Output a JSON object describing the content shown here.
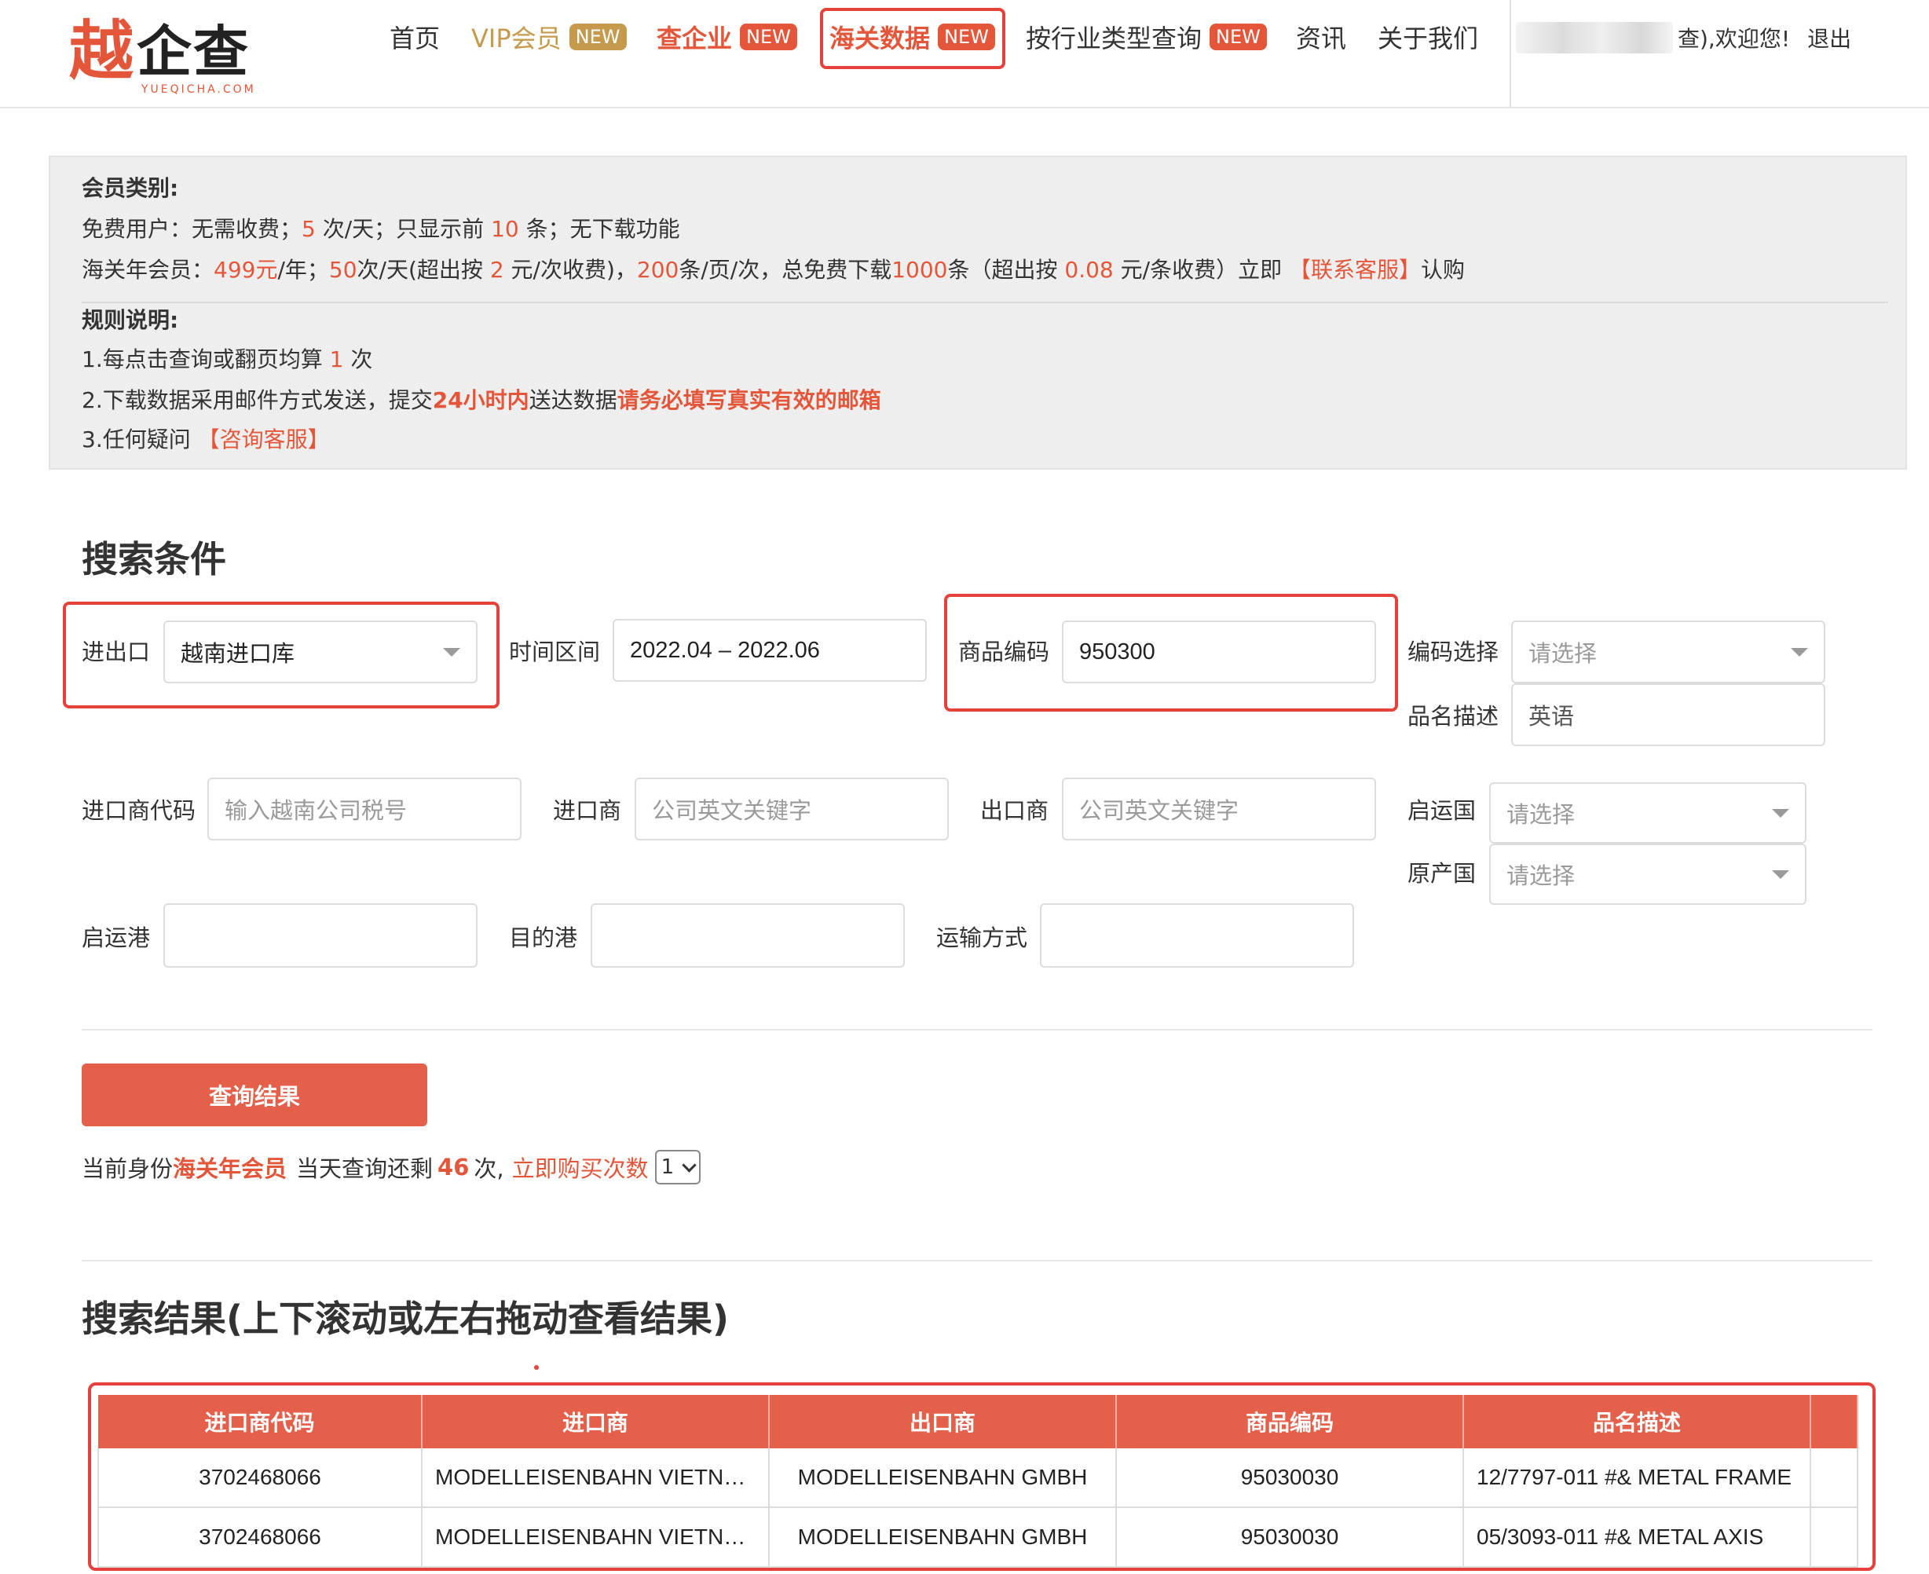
{
  "header": {
    "logo": {
      "main": "越",
      "rest": "企查",
      "sub": "YUEQICHA.COM"
    },
    "nav": [
      {
        "label": "首页"
      },
      {
        "label": "VIP会员",
        "badge": "NEW"
      },
      {
        "label": "查企业",
        "badge": "NEW"
      },
      {
        "label": "海关数据",
        "badge": "NEW"
      },
      {
        "label": "按行业类型查询",
        "badge": "NEW"
      },
      {
        "label": "资讯"
      },
      {
        "label": "关于我们"
      }
    ],
    "user": {
      "welcome": "查),欢迎您!",
      "logout": "退出"
    }
  },
  "membership": {
    "title": "会员类别:",
    "free": {
      "prefix": "免费用户：无需收费；",
      "times": "5",
      "mid": " 次/天；只显示前 ",
      "rows": "10",
      "suffix": " 条；无下载功能"
    },
    "annual": {
      "prefix": "海关年会员：",
      "price": "499元",
      "t1": "/年；",
      "times": "50",
      "t2": "次/天(超出按 ",
      "over_price": "2",
      "t3": " 元/次收费)，",
      "rows": "200",
      "t4": "条/页/次，总免费下载",
      "downloads": "1000",
      "t5": "条（超出按 ",
      "row_price": "0.08",
      "t6": " 元/条收费）立即 ",
      "contact": "【联系客服】",
      "t7": "认购"
    }
  },
  "rules": {
    "title": "规则说明:",
    "r1": {
      "prefix": "1.每点击查询或翻页均算 ",
      "count": "1",
      "suffix": " 次"
    },
    "r2": {
      "prefix": "2.下载数据采用邮件方式发送，提交",
      "hours": "24小时内",
      "mid": "送达数据",
      "email": "请务必填写真实有效的邮箱"
    },
    "r3": {
      "prefix": "3.任何疑问 ",
      "link": "【咨询客服】"
    }
  },
  "search": {
    "heading": "搜索条件",
    "direction": {
      "label": "进出口",
      "value": "越南进口库"
    },
    "period": {
      "label": "时间区间",
      "value": "2022.04 – 2022.06"
    },
    "hs_code": {
      "label": "商品编码",
      "value": "950300"
    },
    "code_select": {
      "label": "编码选择",
      "placeholder": "请选择"
    },
    "product_desc": {
      "label": "品名描述",
      "value": "英语"
    },
    "importer_code": {
      "label": "进口商代码",
      "placeholder": "输入越南公司税号"
    },
    "importer": {
      "label": "进口商",
      "placeholder": "公司英文关键字"
    },
    "exporter": {
      "label": "出口商",
      "placeholder": "公司英文关键字"
    },
    "departure_country": {
      "label": "启运国",
      "placeholder": "请选择"
    },
    "origin_country": {
      "label": "原产国",
      "placeholder": "请选择"
    },
    "departure_port": {
      "label": "启运港",
      "value": ""
    },
    "destination_port": {
      "label": "目的港",
      "value": ""
    },
    "transport": {
      "label": "运输方式",
      "value": ""
    },
    "submit": "查询结果"
  },
  "status": {
    "prefix": "当前身份",
    "identity": "海关年会员",
    "mid": "当天查询还剩",
    "remaining": "46",
    "suffix": "次,",
    "buy": "立即购买次数",
    "select_value": "1"
  },
  "results": {
    "heading": "搜索结果(上下滚动或左右拖动查看结果)",
    "columns": [
      "进口商代码",
      "进口商",
      "出口商",
      "商品编码",
      "品名描述"
    ],
    "rows": [
      [
        "3702468066",
        "MODELLEISENBAHN VIETNAM",
        "MODELLEISENBAHN GMBH",
        "95030030",
        "12/7797-011 #& METAL FRAME"
      ],
      [
        "3702468066",
        "MODELLEISENBAHN VIETNAM",
        "MODELLEISENBAHN GMBH",
        "95030030",
        "05/3093-011 #& METAL AXIS"
      ]
    ]
  },
  "colors": {
    "accent": "#e4563a",
    "gold": "#c59a4c",
    "button": "#e4604a",
    "panel": "#eeeeee"
  }
}
